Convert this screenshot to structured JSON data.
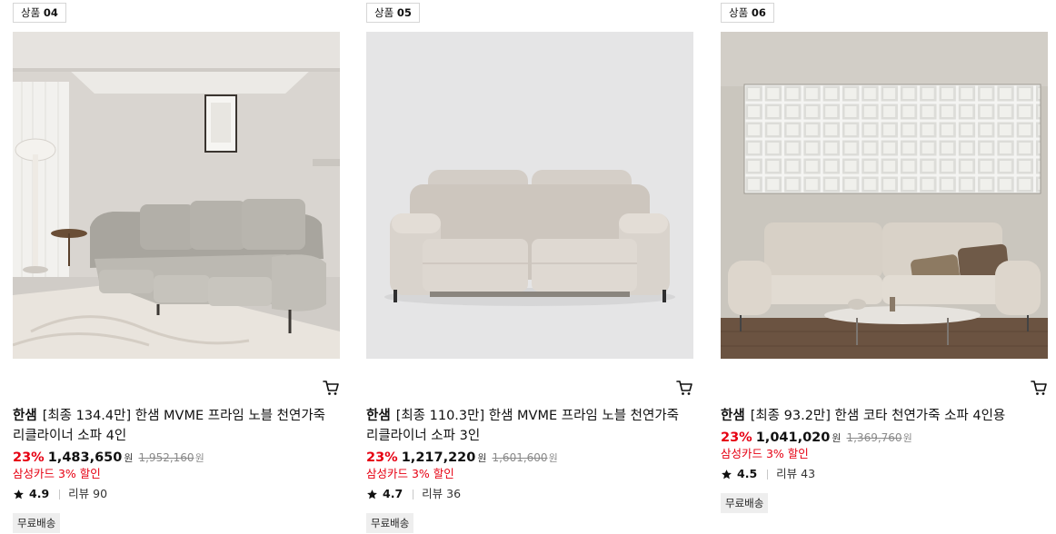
{
  "colors": {
    "discount": "#e60012",
    "text": "#111111",
    "muted": "#8a8a8a",
    "tag_bg": "#eeeeee"
  },
  "products": [
    {
      "rank_prefix": "상품",
      "rank_number": "04",
      "brand": "한샘",
      "name": "[최종 134.4만] 한샘 MVME 프라임 노블 천연가죽 리클라이너 소파 4인",
      "discount": "23%",
      "price": "1,483,650",
      "price_unit": "원",
      "original_price": "1,952,160",
      "original_unit": "원",
      "card_offer": "삼성카드 3% 할인",
      "rating": "4.9",
      "reviews": "리뷰 90",
      "shipping": "무료배송",
      "image": "living-room-4-seat-sofa-photo",
      "cart_icon": "cart-icon"
    },
    {
      "rank_prefix": "상품",
      "rank_number": "05",
      "brand": "한샘",
      "name": "[최종 110.3만] 한샘 MVME 프라임 노블 천연가죽 리클라이너 소파 3인",
      "discount": "23%",
      "price": "1,217,220",
      "price_unit": "원",
      "original_price": "1,601,600",
      "original_unit": "원",
      "card_offer": "삼성카드 3% 할인",
      "rating": "4.7",
      "reviews": "리뷰 36",
      "shipping": "무료배송",
      "image": "studio-recliner-sofa-photo",
      "cart_icon": "cart-icon"
    },
    {
      "rank_prefix": "상품",
      "rank_number": "06",
      "brand": "한샘",
      "name": "[최종 93.2만] 한샘 코타 천연가죽 소파 4인용",
      "discount": "23%",
      "price": "1,041,020",
      "price_unit": "원",
      "original_price": "1,369,760",
      "original_unit": "원",
      "card_offer": "삼성카드 3% 할인",
      "rating": "4.5",
      "reviews": "리뷰 43",
      "shipping": "무료배송",
      "image": "glass-block-wall-sofa-photo",
      "cart_icon": "cart-icon"
    }
  ]
}
